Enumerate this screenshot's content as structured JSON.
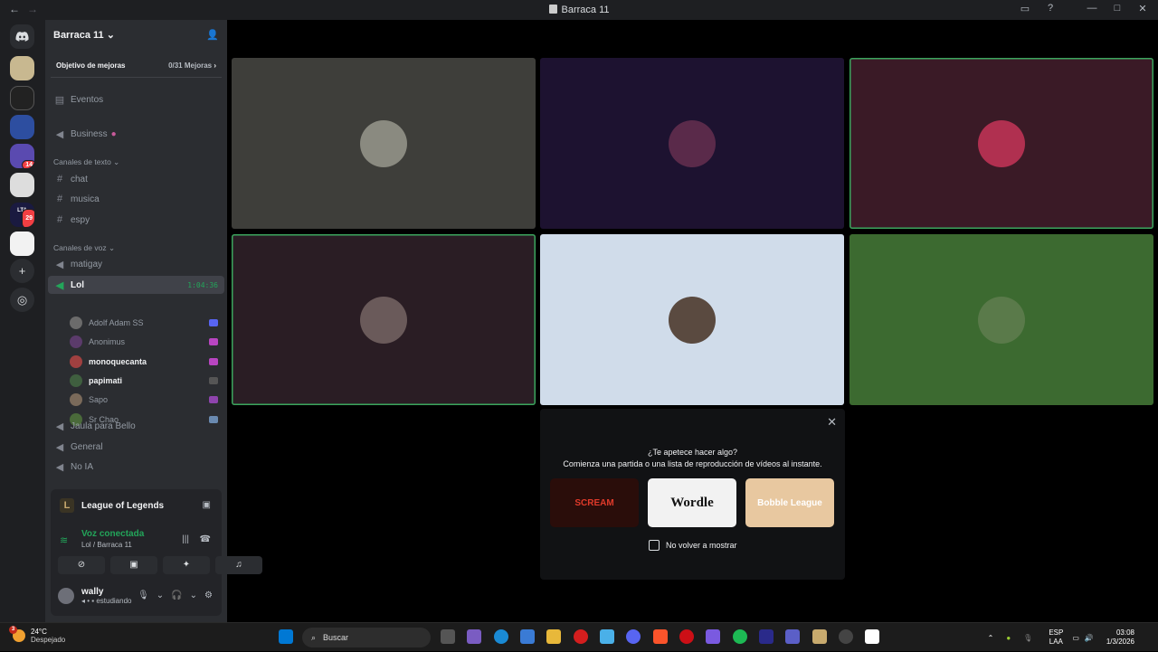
{
  "window": {
    "title": "Barraca 11"
  },
  "server": {
    "name": "Barraca 11",
    "boost_label": "Objetivo de mejoras",
    "boost_count": "0/31 Mejoras"
  },
  "guild_badges": {
    "g5": "14",
    "g7": "29",
    "g6_label": "LTA"
  },
  "channels": {
    "events": "Eventos",
    "business": "Business",
    "text_category": "Canales de texto",
    "text": [
      "chat",
      "musica",
      "espy"
    ],
    "voice_category": "Canales de voz",
    "voice_before": "matigay",
    "active_voice": "Lol",
    "active_timer": "1:04:36",
    "voice_after": [
      "Jaula para Bello",
      "General",
      "No IA"
    ]
  },
  "members": [
    {
      "name": "Adolf Adam SS",
      "bold": false,
      "color": "#6b6b6b",
      "act": "#5865f2"
    },
    {
      "name": "Anonimus",
      "bold": false,
      "color": "#5b3b6b",
      "act": "#b845c1"
    },
    {
      "name": "monoquecanta",
      "bold": true,
      "color": "#a04040",
      "act": "#b845c1"
    },
    {
      "name": "papimati",
      "bold": true,
      "color": "#3f5f3f",
      "act": "#555555"
    },
    {
      "name": "Sapo",
      "bold": false,
      "color": "#7a6a5a",
      "act": "#8e44ad"
    },
    {
      "name": "Sr Chao",
      "bold": false,
      "color": "#4a6a3a",
      "act": "#6a8ab0"
    }
  ],
  "activity": {
    "game": "League of Legends",
    "voice_status": "Voz conectada",
    "voice_location": "Lol / Barraca 11"
  },
  "user": {
    "name": "wally",
    "status": "estudiando"
  },
  "tiles": [
    {
      "bg": "#3e3e3a",
      "avatar": "#8a8a80",
      "speaking": false
    },
    {
      "bg": "#1d1230",
      "avatar": "#5a2a4a",
      "speaking": false
    },
    {
      "bg": "#3a1a26",
      "avatar": "#b03050",
      "speaking": true
    },
    {
      "bg": "#2a1d24",
      "avatar": "#6a5a5a",
      "speaking": true
    },
    {
      "bg": "#d0dcea",
      "avatar": "#5a4a40",
      "speaking": false
    },
    {
      "bg": "#3c6a30",
      "avatar": "#5a7a4a",
      "speaking": false
    }
  ],
  "popup": {
    "question": "¿Te apetece hacer algo?",
    "description": "Comienza una partida o una lista de reproducción de vídeos al instante.",
    "cards": [
      {
        "label": "SCREAM",
        "bg": "#2a0d0a",
        "fg": "#e03a2a"
      },
      {
        "label": "Wordle",
        "bg": "#f2f2f2",
        "fg": "#111111"
      },
      {
        "label": "Bobble League",
        "bg": "#e8c8a0",
        "fg": "#ffffff"
      }
    ],
    "checkbox_label": "No volver a mostrar"
  },
  "taskbar": {
    "temperature": "24°C",
    "condition": "Despejado",
    "weather_badge": "3",
    "search_placeholder": "Buscar",
    "lang_1": "ESP",
    "lang_2": "LAA",
    "time": "03:08",
    "date": "1/3/2026"
  }
}
